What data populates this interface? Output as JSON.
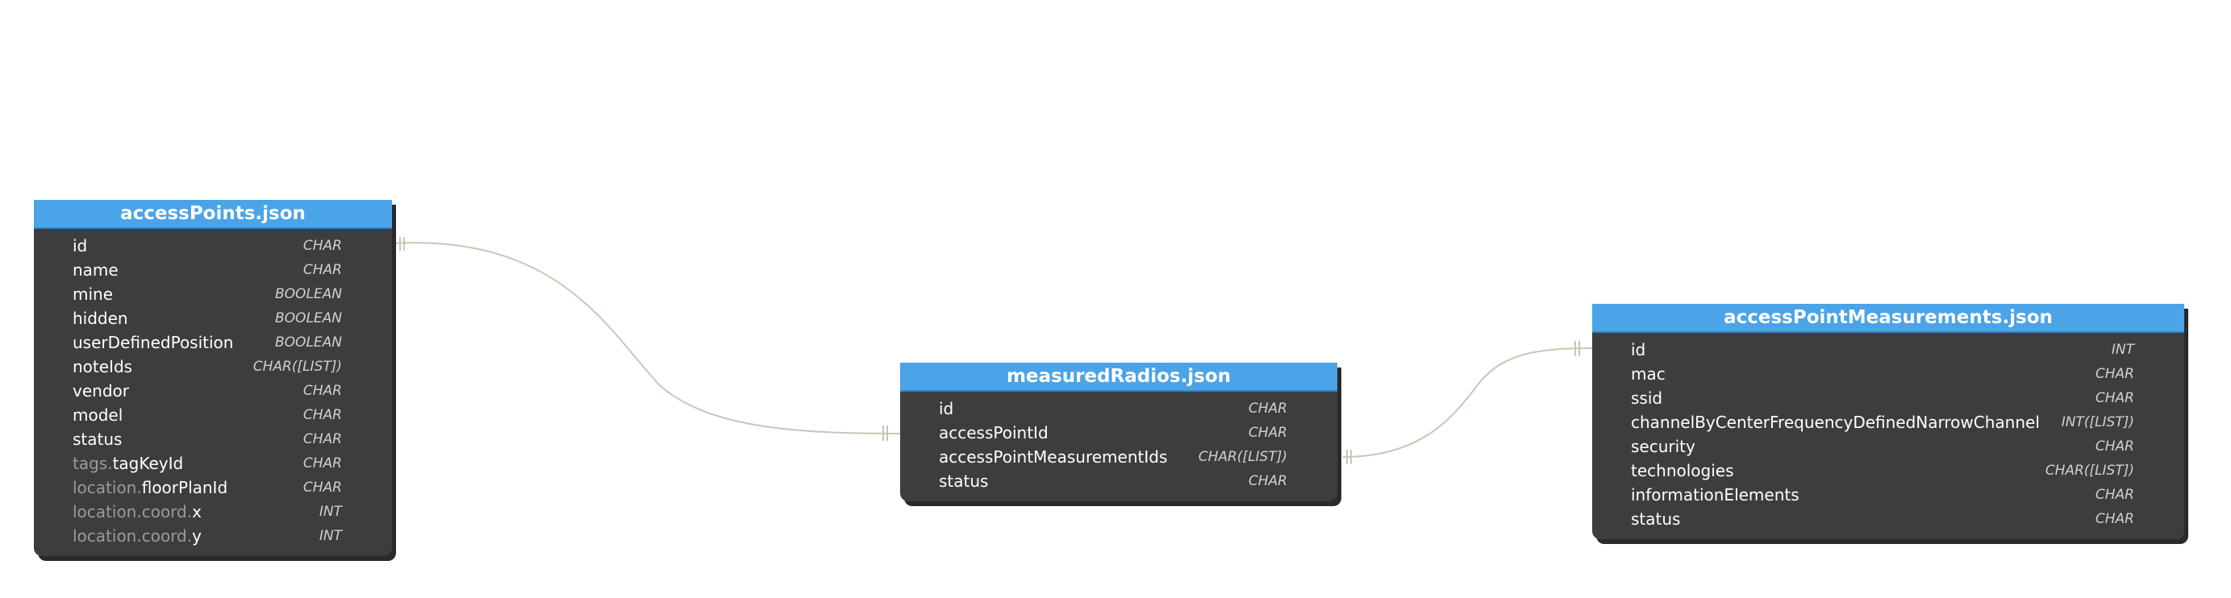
{
  "colors": {
    "background": "#ffffff",
    "table_header": "#4ba3e8",
    "table_body": "#3d3d3d",
    "connector": "#c9c6b8",
    "prefix_text": "#9a9a9a"
  },
  "tables": {
    "access_points": {
      "title": "accessPoints.json",
      "columns": [
        {
          "prefix": "",
          "name": "id",
          "type": "CHAR"
        },
        {
          "prefix": "",
          "name": "name",
          "type": "CHAR"
        },
        {
          "prefix": "",
          "name": "mine",
          "type": "BOOLEAN"
        },
        {
          "prefix": "",
          "name": "hidden",
          "type": "BOOLEAN"
        },
        {
          "prefix": "",
          "name": "userDefinedPosition",
          "type": "BOOLEAN"
        },
        {
          "prefix": "",
          "name": "noteIds",
          "type": "CHAR([LIST])"
        },
        {
          "prefix": "",
          "name": "vendor",
          "type": "CHAR"
        },
        {
          "prefix": "",
          "name": "model",
          "type": "CHAR"
        },
        {
          "prefix": "",
          "name": "status",
          "type": "CHAR"
        },
        {
          "prefix": "tags.",
          "name": "tagKeyId",
          "type": "CHAR"
        },
        {
          "prefix": "location.",
          "name": "floorPlanId",
          "type": "CHAR"
        },
        {
          "prefix": "location.coord.",
          "name": "x",
          "type": "INT"
        },
        {
          "prefix": "location.coord.",
          "name": "y",
          "type": "INT"
        }
      ]
    },
    "measured_radios": {
      "title": "measuredRadios.json",
      "columns": [
        {
          "prefix": "",
          "name": "id",
          "type": "CHAR"
        },
        {
          "prefix": "",
          "name": "accessPointId",
          "type": "CHAR"
        },
        {
          "prefix": "",
          "name": "accessPointMeasurementIds",
          "type": "CHAR([LIST])"
        },
        {
          "prefix": "",
          "name": "status",
          "type": "CHAR"
        }
      ]
    },
    "access_point_measurements": {
      "title": "accessPointMeasurements.json",
      "columns": [
        {
          "prefix": "",
          "name": "id",
          "type": "INT"
        },
        {
          "prefix": "",
          "name": "mac",
          "type": "CHAR"
        },
        {
          "prefix": "",
          "name": "ssid",
          "type": "CHAR"
        },
        {
          "prefix": "",
          "name": "channelByCenterFrequencyDefinedNarrowChannel",
          "type": "INT([LIST])"
        },
        {
          "prefix": "",
          "name": "security",
          "type": "CHAR"
        },
        {
          "prefix": "",
          "name": "technologies",
          "type": "CHAR([LIST])"
        },
        {
          "prefix": "",
          "name": "informationElements",
          "type": "CHAR"
        },
        {
          "prefix": "",
          "name": "status",
          "type": "CHAR"
        }
      ]
    }
  },
  "relationships": [
    {
      "from_table": "accessPoints.json",
      "from_column": "id",
      "to_table": "measuredRadios.json",
      "to_column": "accessPointId",
      "cardinality": "one-to-one"
    },
    {
      "from_table": "measuredRadios.json",
      "from_column": "accessPointMeasurementIds",
      "to_table": "accessPointMeasurements.json",
      "to_column": "id",
      "cardinality": "one-to-one"
    }
  ]
}
